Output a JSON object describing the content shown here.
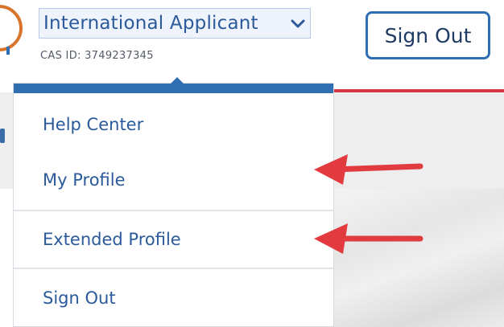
{
  "header": {
    "applicant_select": {
      "value": "International Applicant"
    },
    "cas_id": "CAS ID: 3749237345",
    "sign_out_button": "Sign Out"
  },
  "menu": {
    "items": [
      {
        "label": "Help Center"
      },
      {
        "label": "My Profile"
      },
      {
        "label": "Extended Profile"
      },
      {
        "label": "Sign Out"
      }
    ]
  },
  "colors": {
    "accent_blue": "#2f6eb0",
    "link_text": "#2b5a9a",
    "annotation_arrow": "#e23b3f",
    "header_rule": "#d4373f"
  },
  "icons": [
    "chevron-down-icon",
    "arrow-left-icon"
  ]
}
